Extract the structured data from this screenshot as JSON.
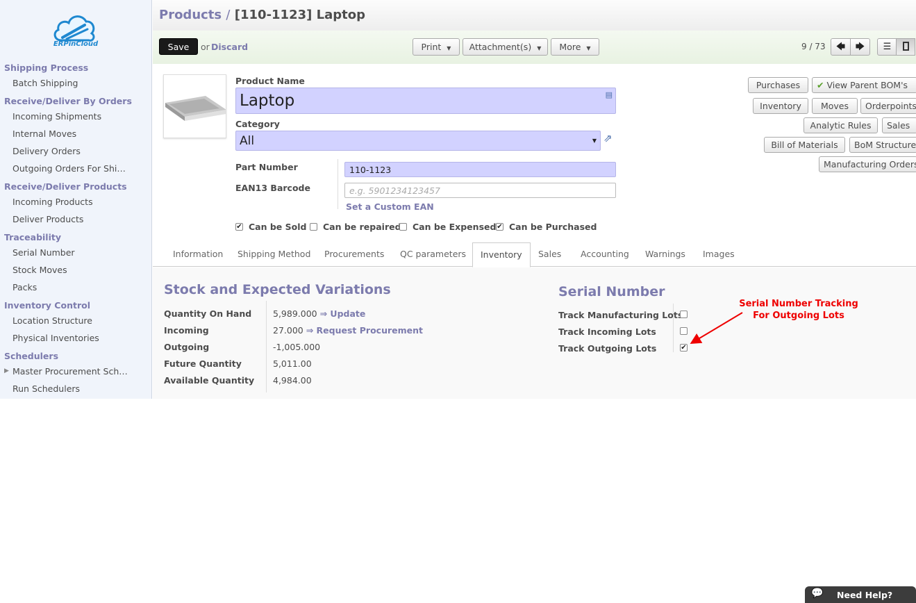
{
  "brand": {
    "logo_text": "ERPinCloud"
  },
  "sidebar": {
    "sections": [
      {
        "title": "Shipping Process",
        "items": [
          "Batch Shipping"
        ]
      },
      {
        "title": "Receive/Deliver By Orders",
        "items": [
          "Incoming Shipments",
          "Internal Moves",
          "Delivery Orders",
          "Outgoing Orders For Shipping"
        ]
      },
      {
        "title": "Receive/Deliver Products",
        "items": [
          "Incoming Products",
          "Deliver Products"
        ]
      },
      {
        "title": "Traceability",
        "items": [
          "Serial Number",
          "Stock Moves",
          "Packs"
        ]
      },
      {
        "title": "Inventory Control",
        "items": [
          "Location Structure",
          "Physical Inventories"
        ]
      },
      {
        "title": "Schedulers",
        "items": [
          "Master Procurement Schedule",
          "Run Schedulers"
        ]
      }
    ]
  },
  "header": {
    "breadcrumb_parent": "Products",
    "breadcrumb_sep": "/",
    "breadcrumb_current": "[110-1123] Laptop",
    "save_label": "Save",
    "or_text": "or",
    "discard_label": "Discard",
    "print_label": "Print",
    "attachments_label": "Attachment(s)",
    "more_label": "More",
    "pager_text": "9 / 73"
  },
  "form": {
    "product_name_label": "Product Name",
    "product_name": "Laptop",
    "category_label": "Category",
    "category": "All",
    "part_number_label": "Part Number",
    "part_number": "110-1123",
    "ean13_label": "EAN13 Barcode",
    "ean13_placeholder": "e.g. 5901234123457",
    "set_custom_ean": "Set a Custom EAN",
    "checkboxes": [
      {
        "label": "Can be Sold",
        "checked": true
      },
      {
        "label": "Can be repaired",
        "checked": false
      },
      {
        "label": "Can be Expensed",
        "checked": false
      },
      {
        "label": "Can be Purchased",
        "checked": true
      }
    ]
  },
  "smart_buttons": {
    "purchases": "Purchases",
    "view_parent_bom": "View Parent BOM's",
    "inventory": "Inventory",
    "moves": "Moves",
    "orderpoints": "Orderpoints",
    "analytic_rules": "Analytic Rules",
    "sales": "Sales",
    "bill_of_materials": "Bill of Materials",
    "bom_structure": "BoM Structure",
    "manufacturing_orders": "Manufacturing Orders"
  },
  "tabs": [
    "Information",
    "Shipping Method",
    "Procurements",
    "QC parameters",
    "Inventory",
    "Sales",
    "Accounting",
    "Warnings",
    "Images"
  ],
  "active_tab": "Inventory",
  "stock": {
    "title": "Stock and Expected Variations",
    "rows": [
      {
        "label": "Quantity On Hand",
        "value": "5,989.000",
        "action": "⇒ Update"
      },
      {
        "label": "Incoming",
        "value": "27.000",
        "action": "⇒ Request Procurement"
      },
      {
        "label": "Outgoing",
        "value": "-1,005.000",
        "action": ""
      },
      {
        "label": "Future Quantity",
        "value": "5,011.00",
        "action": ""
      },
      {
        "label": "Available Quantity",
        "value": "4,984.00",
        "action": ""
      }
    ]
  },
  "serial": {
    "title": "Serial Number",
    "rows": [
      {
        "label": "Track Manufacturing Lots",
        "checked": false
      },
      {
        "label": "Track Incoming Lots",
        "checked": false
      },
      {
        "label": "Track Outgoing Lots",
        "checked": true
      }
    ]
  },
  "annotation": {
    "line1": "Serial Number Tracking",
    "line2": "For Outgoing Lots"
  },
  "help": {
    "label": "Need Help?"
  },
  "colors": {
    "accent": "#7c7bad",
    "required_field": "#d2d2ff",
    "annotation": "#e00000"
  }
}
